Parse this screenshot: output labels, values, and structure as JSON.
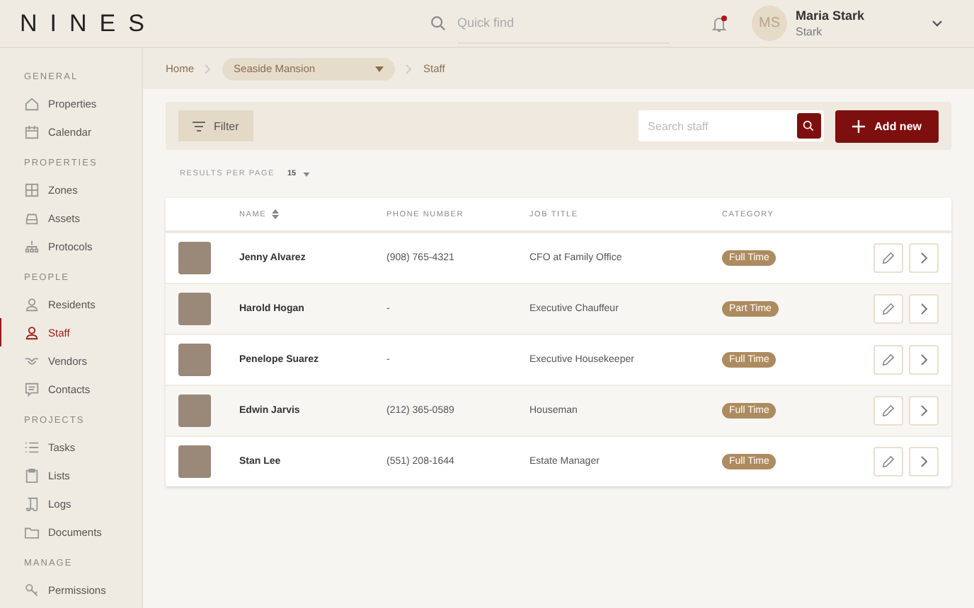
{
  "header": {
    "logo": "NINES",
    "search": {
      "placeholder": "Quick find"
    },
    "notifications": {
      "unread": true
    },
    "user": {
      "initials": "MS",
      "name": "Maria Stark",
      "subtitle": "Stark"
    }
  },
  "sidebar": {
    "sections": [
      {
        "title": "GENERAL",
        "items": [
          {
            "label": "Properties",
            "selected": false
          },
          {
            "label": "Calendar",
            "selected": false
          }
        ]
      },
      {
        "title": "PROPERTIES",
        "items": [
          {
            "label": "Zones",
            "selected": false
          },
          {
            "label": "Assets",
            "selected": false
          },
          {
            "label": "Protocols",
            "selected": false
          }
        ]
      },
      {
        "title": "PEOPLE",
        "items": [
          {
            "label": "Residents",
            "selected": false
          },
          {
            "label": "Staff",
            "selected": true
          },
          {
            "label": "Vendors",
            "selected": false
          },
          {
            "label": "Contacts",
            "selected": false
          }
        ]
      },
      {
        "title": "PROJECTS",
        "items": [
          {
            "label": "Tasks",
            "selected": false
          },
          {
            "label": "Lists",
            "selected": false
          },
          {
            "label": "Logs",
            "selected": false
          },
          {
            "label": "Documents",
            "selected": false
          }
        ]
      },
      {
        "title": "MANAGE",
        "items": [
          {
            "label": "Permissions",
            "selected": false
          }
        ]
      }
    ]
  },
  "breadcrumb": {
    "home": "Home",
    "property": "Seaside Mansion",
    "current": "Staff"
  },
  "toolbar": {
    "filter": "Filter",
    "search": {
      "placeholder": "Search staff"
    },
    "add": "Add new"
  },
  "results_per_page": {
    "label": "RESULTS PER PAGE",
    "value": "15"
  },
  "table": {
    "columns": [
      "NAME",
      "PHONE NUMBER",
      "JOB TITLE",
      "CATEGORY"
    ],
    "rows": [
      {
        "name": "Jenny Alvarez",
        "phone": "(908) 765-4321",
        "job_title": "CFO at Family Office",
        "category": "Full Time"
      },
      {
        "name": "Harold Hogan",
        "phone": "-",
        "job_title": "Executive Chauffeur",
        "category": "Part Time"
      },
      {
        "name": "Penelope Suarez",
        "phone": "-",
        "job_title": "Executive Housekeeper",
        "category": "Full Time"
      },
      {
        "name": "Edwin Jarvis",
        "phone": "(212) 365-0589",
        "job_title": "Houseman",
        "category": "Full Time"
      },
      {
        "name": "Stan Lee",
        "phone": "(551) 208-1644",
        "job_title": "Estate Manager",
        "category": "Full Time"
      }
    ]
  }
}
